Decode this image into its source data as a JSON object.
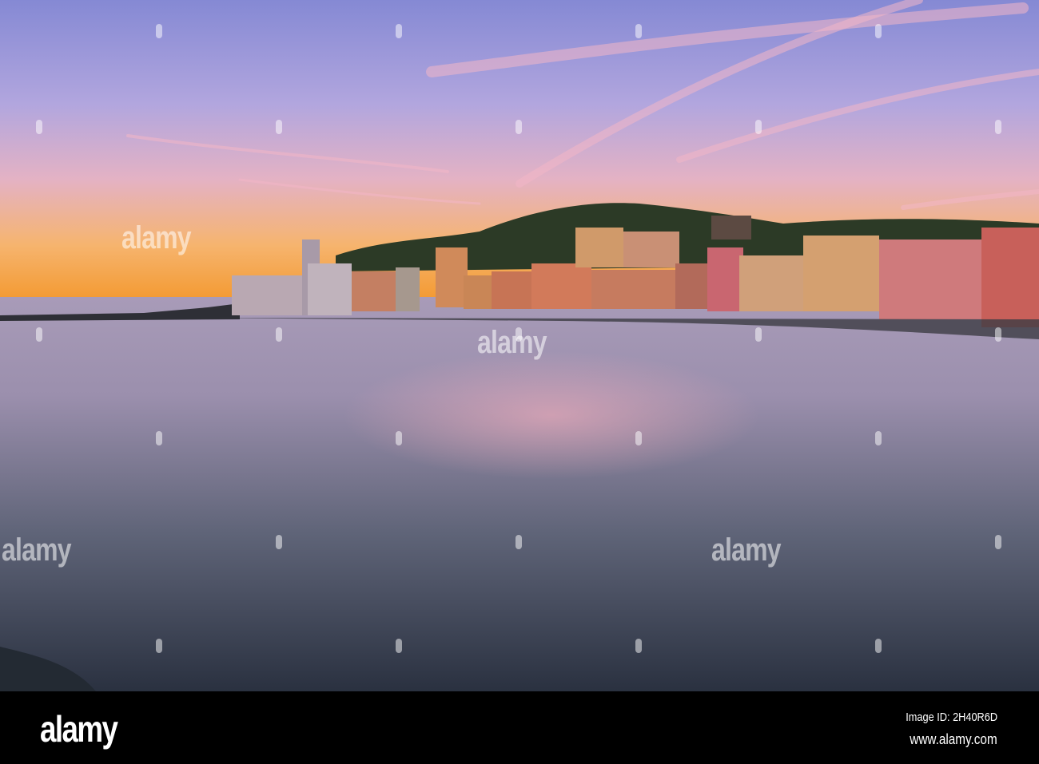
{
  "watermark": {
    "text": "alamy"
  },
  "footer": {
    "logo": "alamy",
    "image_id": "Image ID: 2H40R6D",
    "website": "www.alamy.com"
  },
  "colors": {
    "sky_top": "#8d8fd6",
    "sky_mid": "#c9a7d8",
    "horizon": "#f4a23c",
    "water_top": "#b7a6c8",
    "water_bottom": "#2b3340"
  }
}
